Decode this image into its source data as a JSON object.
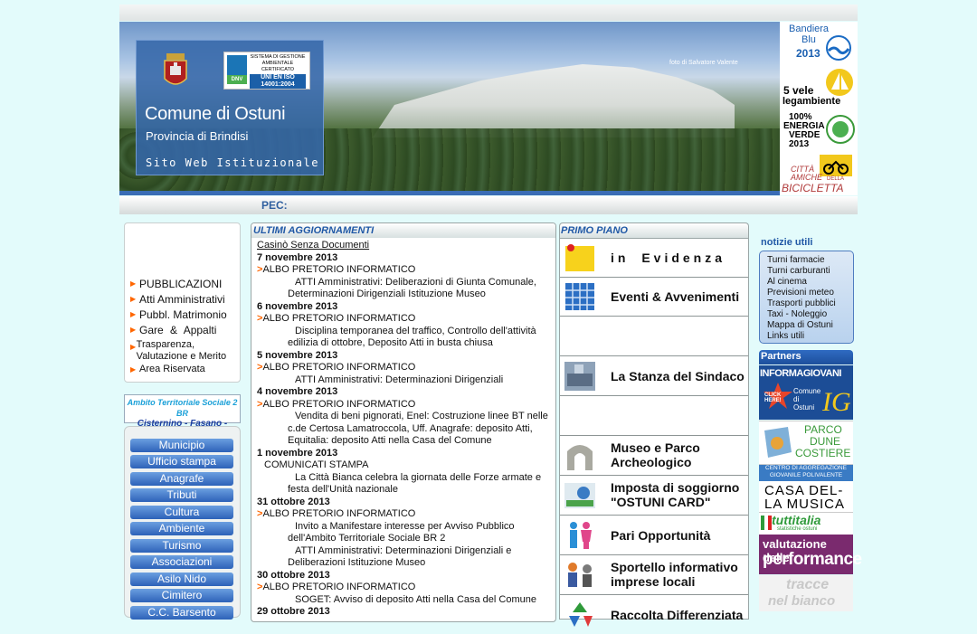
{
  "banner": {
    "comune": "Comune di Ostuni",
    "provincia": "Provincia di Brindisi",
    "sito": "Sito Web Istituzionale",
    "photo_credit": "foto di Salvatore Valente",
    "iso_text": "SISTEMA DI GESTIONE AMBIENTALE CERTIFICATO",
    "iso_norm": "UNI EN ISO 14001:2004",
    "iso_logo": "DNV"
  },
  "badges": {
    "bandiera_line1": "Bandiera",
    "bandiera_line2": "Blu",
    "bandiera_year": "2013",
    "vele_line1": "5 vele",
    "vele_line2": "legambiente",
    "energia_line1": "100%",
    "energia_line2": "ENERGIA",
    "energia_line3": "VERDE",
    "energia_year": "2013",
    "bici_line1": "CITTÀ",
    "bici_line2": "AMICHE",
    "bici_line3": "DELLA",
    "bici_line4": "BICICLETTA"
  },
  "pec_label": "PEC:",
  "left_menu": [
    "PUBBLICAZIONI",
    "Atti Amministrativi",
    "Pubbl. Matrimonio",
    "Gare & Appalti",
    "Trasparenza, Valutazione e Merito",
    "Area Riservata"
  ],
  "ambito": {
    "line1": "Ambito Territoriale Sociale 2 BR",
    "line2": "Cisternino - Fasano - Ostuni"
  },
  "nav_buttons": [
    "Municipio",
    "Ufficio stampa",
    "Anagrafe",
    "Tributi",
    "Cultura",
    "Ambiente",
    "Turismo",
    "Associazioni",
    "Asilo Nido",
    "Cimitero",
    "C.C. Barsento"
  ],
  "updates": {
    "title": "ULTIMI AGGIORNAMENTI",
    "top_link": "Casinò Senza Documenti",
    "entries": [
      {
        "type": "date",
        "text": "7 novembre 2013"
      },
      {
        "type": "cat",
        "text": "ALBO PRETORIO INFORMATICO"
      },
      {
        "type": "desc",
        "text": "ATTI Amministrativi: Deliberazioni di Giunta Comunale, Determinazioni Dirigenziali Istituzione Museo"
      },
      {
        "type": "date",
        "text": "6 novembre 2013"
      },
      {
        "type": "cat",
        "text": "ALBO PRETORIO INFORMATICO"
      },
      {
        "type": "desc",
        "text": "Disciplina temporanea del traffico, Controllo dell'attività edilizia di ottobre, Deposito Atti in busta chiusa"
      },
      {
        "type": "date",
        "text": "5 novembre 2013"
      },
      {
        "type": "cat",
        "text": "ALBO PRETORIO INFORMATICO"
      },
      {
        "type": "desc",
        "text": "ATTI Amministrativi: Determinazioni Dirigenziali"
      },
      {
        "type": "date",
        "text": "4 novembre 2013"
      },
      {
        "type": "cat",
        "text": "ALBO PRETORIO INFORMATICO"
      },
      {
        "type": "desc",
        "text": "Vendita di beni pignorati, Enel: Costruzione linee BT nelle c.de Certosa Lamatroccola, Uff. Anagrafe: deposito Atti, Equitalia: deposito Atti nella Casa del Comune"
      },
      {
        "type": "date",
        "text": "1 novembre 2013"
      },
      {
        "type": "catnoarr",
        "text": "COMUNICATI STAMPA"
      },
      {
        "type": "desc",
        "text": "La Città Bianca celebra la giornata delle Forze armate e festa dell'Unità nazionale"
      },
      {
        "type": "date",
        "text": "31 ottobre 2013"
      },
      {
        "type": "cat",
        "text": "ALBO PRETORIO INFORMATICO"
      },
      {
        "type": "desc",
        "text": "Invito a Manifestare interesse per Avviso Pubblico dell'Ambito Territoriale Sociale BR 2"
      },
      {
        "type": "desc",
        "text": "ATTI Amministrativi: Determinazioni Dirigenziali e Deliberazioni Istituzione Museo"
      },
      {
        "type": "date",
        "text": "30 ottobre 2013"
      },
      {
        "type": "cat",
        "text": "ALBO PRETORIO INFORMATICO"
      },
      {
        "type": "desc",
        "text": "SOGET: Avviso di deposito Atti nella Casa del Comune"
      },
      {
        "type": "date",
        "text": "29 ottobre 2013"
      }
    ]
  },
  "primo_piano": {
    "title": "PRIMO PIANO",
    "items": [
      {
        "label": "in   Evidenza",
        "icon": "pin-note-icon"
      },
      {
        "label": "Eventi & Avvenimenti",
        "icon": "calendar-icon"
      },
      {
        "label": "",
        "icon": ""
      },
      {
        "label": "La Stanza del Sindaco",
        "icon": "office-icon"
      },
      {
        "label": "",
        "icon": ""
      },
      {
        "label": "Museo e Parco Archeologico",
        "icon": "arch-icon"
      },
      {
        "label": "Imposta di soggiorno \"OSTUNI CARD\"",
        "icon": "card-icon"
      },
      {
        "label": "Pari Opportunità",
        "icon": "people-icon"
      },
      {
        "label": "Sportello informativo imprese locali",
        "icon": "business-icon"
      },
      {
        "label": "Raccolta Differenziata",
        "icon": "recycle-icon"
      }
    ]
  },
  "notizie": {
    "title": "notizie utili",
    "items": [
      "Turni farmacie",
      "Turni carburanti",
      "Al cinema",
      "Previsioni meteo",
      "Trasporti pubblici",
      "Taxi - Noleggio",
      "Mappa di Ostuni",
      "Links utili"
    ]
  },
  "partners": {
    "title": "Partners",
    "informagiovani": "INFORMAGIOVANI",
    "ig_click": "CLICK HERE!",
    "ig_comune": "Comune di Ostuni",
    "parco_line1": "PARCO",
    "parco_line2": "DUNE",
    "parco_line3": "COSTIERE",
    "casa_top": "CENTRO DI AGGREGAZIONE GIOVANILE POLIVALENTE",
    "casa_line1": "CASA DEL-",
    "casa_line2": "LA MUSICA",
    "tuttitalia": "tuttitalia",
    "tuttitalia_sub": "statistiche ostuni",
    "valutazione_line1": "valutazione delle",
    "valutazione_line2": "performance",
    "tracce_line1": "tracce",
    "tracce_line2": "nel bianco"
  }
}
